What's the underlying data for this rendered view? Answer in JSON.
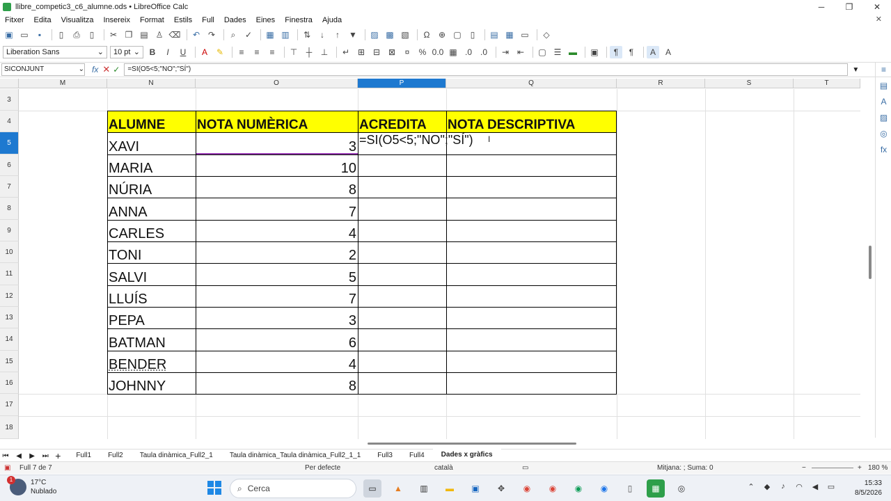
{
  "window": {
    "title": "llibre_competic3_c6_alumne.ods • LibreOffice Calc"
  },
  "window_controls": {
    "minimize": "─",
    "maximize": "❐",
    "close": "✕"
  },
  "menu": [
    "Fitxer",
    "Edita",
    "Visualitza",
    "Insereix",
    "Format",
    "Estils",
    "Full",
    "Dades",
    "Eines",
    "Finestra",
    "Ajuda"
  ],
  "format_bar": {
    "font_name": "Liberation Sans",
    "font_size": "10 pt"
  },
  "formula_bar": {
    "name_box": "SICONJUNT",
    "formula": "=SI(O5<5;\"NO\";\"SÍ\")"
  },
  "columns": [
    "M",
    "N",
    "O",
    "P",
    "Q",
    "R",
    "S",
    "T"
  ],
  "rows": [
    "3",
    "4",
    "5",
    "6",
    "7",
    "8",
    "9",
    "10",
    "11",
    "12",
    "13",
    "14",
    "15",
    "16",
    "17",
    "18"
  ],
  "table": {
    "headers": [
      "ALUMNE",
      "NOTA NUMÈRICA",
      "ACREDITA",
      "NOTA DESCRIPTIVA"
    ],
    "editing_formula": "=SI(O5<5;\"NO\";\"SÍ\")",
    "students": [
      {
        "name": "XAVI",
        "grade": "3"
      },
      {
        "name": "MARIA",
        "grade": "10"
      },
      {
        "name": "NÚRIA",
        "grade": "8"
      },
      {
        "name": "ANNA",
        "grade": "7"
      },
      {
        "name": "CARLES",
        "grade": "4"
      },
      {
        "name": "TONI",
        "grade": "2"
      },
      {
        "name": "SALVI",
        "grade": "5"
      },
      {
        "name": "LLUÍS",
        "grade": "7"
      },
      {
        "name": "PEPA",
        "grade": "3"
      },
      {
        "name": "BATMAN",
        "grade": "6"
      },
      {
        "name": "BENDER",
        "grade": "4"
      },
      {
        "name": "JOHNNY",
        "grade": "8"
      }
    ]
  },
  "sheet_tabs": [
    "Full1",
    "Full2",
    "Taula dinàmica_Full2_1",
    "Taula dinàmica_Taula dinàmica_Full2_1_1",
    "Full3",
    "Full4",
    "Dades x gràfics"
  ],
  "active_tab": "Dades x gràfics",
  "status": {
    "sheet": "Full 7 de 7",
    "style": "Per defecte",
    "language": "català",
    "sum": "Mitjana: ; Suma: 0",
    "zoom": "180 %"
  },
  "taskbar": {
    "weather_temp": "17°C",
    "weather_desc": "Nublado",
    "notification_count": "1",
    "search_placeholder": "Cerca",
    "time": "15:33",
    "date": "8/5/2026"
  },
  "colors": {
    "header_fill": "#ffff00",
    "selection": "#1e79d0"
  }
}
